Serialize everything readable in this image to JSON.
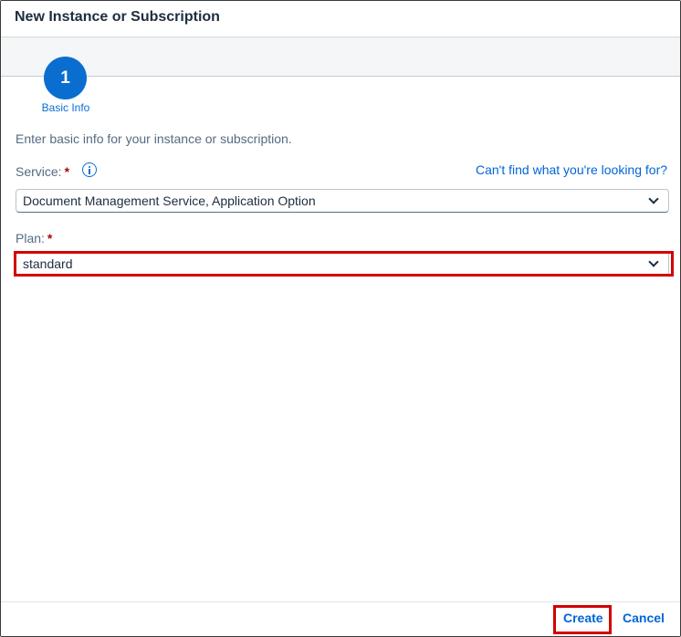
{
  "dialog": {
    "title": "New Instance or Subscription"
  },
  "wizard": {
    "step_number": "1",
    "step_label": "Basic Info"
  },
  "form": {
    "intro": "Enter basic info for your instance or subscription.",
    "service_label": "Service:",
    "required_mark": "*",
    "help_link": "Can't find what you're looking for?",
    "service_value": "Document Management Service, Application Option",
    "plan_label": "Plan:",
    "plan_value": "standard"
  },
  "footer": {
    "create_label": "Create",
    "cancel_label": "Cancel"
  },
  "colors": {
    "accent": "#0a6ed1",
    "link": "#0064d9",
    "highlight": "#d40000",
    "required": "#aa0808"
  }
}
